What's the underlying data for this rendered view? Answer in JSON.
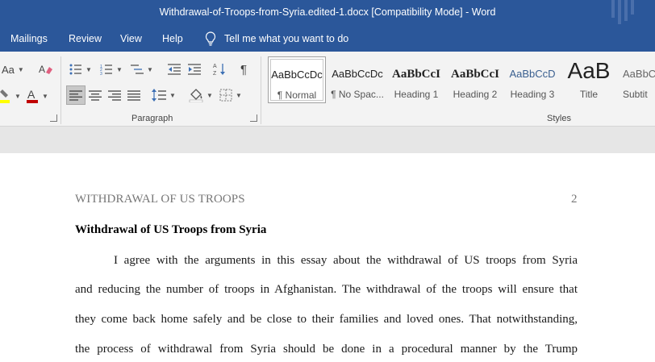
{
  "window": {
    "title": "Withdrawal-of-Troops-from-Syria.edited-1.docx [Compatibility Mode]  -  Word"
  },
  "menu": {
    "items": [
      "Mailings",
      "Review",
      "View",
      "Help"
    ],
    "tell_me": "Tell me what you want to do"
  },
  "ribbon": {
    "font_size_label": "Aa",
    "paragraph_label": "Paragraph",
    "styles_label": "Styles",
    "styles": [
      {
        "sample": "AaBbCcDc",
        "name": "¶ Normal"
      },
      {
        "sample": "AaBbCcDc",
        "name": "¶ No Spac..."
      },
      {
        "sample": "AaBbCcI",
        "name": "Heading 1"
      },
      {
        "sample": "AaBbCcI",
        "name": "Heading 2"
      },
      {
        "sample": "AaBbCcD",
        "name": "Heading 3"
      },
      {
        "sample": "AaB",
        "name": "Title"
      },
      {
        "sample": "AaBbC",
        "name": "Subtit"
      }
    ],
    "colors": {
      "highlight": "#ffff00",
      "font_color": "#c00000"
    }
  },
  "document": {
    "header_text": "WITHDRAWAL OF US TROOPS",
    "page_number": "2",
    "title": "Withdrawal of US Troops from Syria",
    "lines": [
      "I agree with the arguments in this essay about the withdrawal of US troops from Syria",
      "and reducing the number of troops in Afghanistan. The withdrawal of the troops will ensure that",
      "they come back home safely and be close to their families and loved ones. That notwithstanding,",
      "the process of withdrawal from Syria should be done in a procedural manner by the Trump"
    ]
  },
  "colors": {
    "titlebar": "#2b579a",
    "ribbon": "#f3f3f3"
  }
}
